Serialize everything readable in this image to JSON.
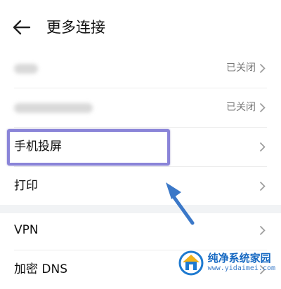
{
  "header": {
    "title": "更多连接"
  },
  "rows": [
    {
      "label": "",
      "status": "已关闭"
    },
    {
      "label": "",
      "status": "已关闭"
    },
    {
      "label": "手机投屏",
      "status": ""
    },
    {
      "label": "打印",
      "status": ""
    },
    {
      "label": "VPN",
      "status": ""
    },
    {
      "label": "加密 DNS",
      "status": ""
    }
  ],
  "watermark": {
    "name": "纯净系统家园",
    "url": "www.yidaimei.com"
  },
  "colors": {
    "highlight": "#8a84d8",
    "arrow": "#3b78c8",
    "section_bg": "#f1f3f5"
  }
}
